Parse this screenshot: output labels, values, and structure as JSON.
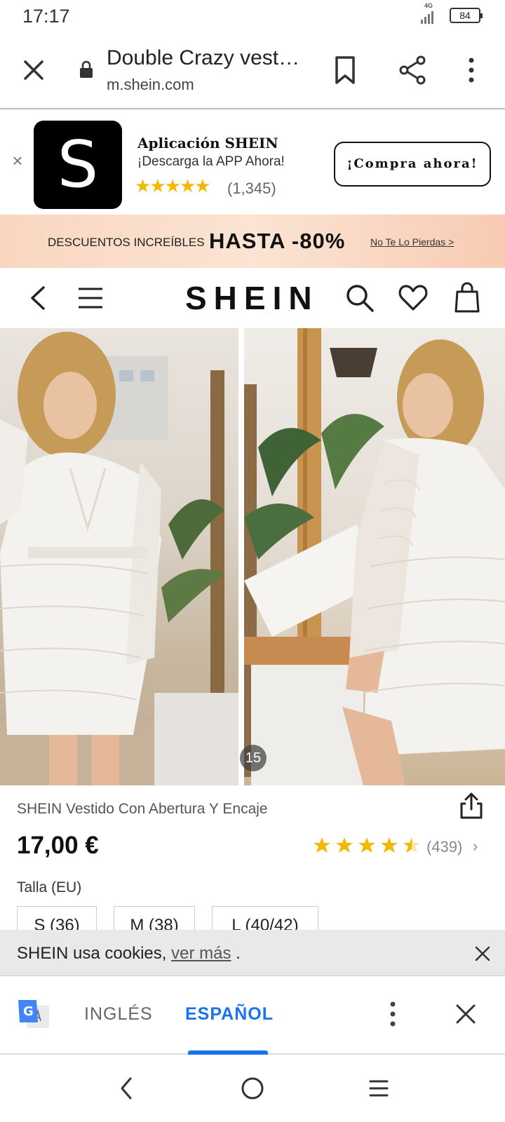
{
  "status_bar": {
    "time": "17:17",
    "network": "4G",
    "battery": "84"
  },
  "browser": {
    "title": "Double Crazy vest…",
    "url": "m.shein.com",
    "icons": [
      "close-icon",
      "lock-icon",
      "bookmark-icon",
      "share-icon",
      "more-vert-icon"
    ]
  },
  "app_banner": {
    "logo_letter": "S",
    "name": "Aplicación SHEIN",
    "tagline": "¡Descarga la APP Ahora!",
    "stars": "★★★★★",
    "rating_count": "(1,345)",
    "cta": "¡Compra ahora!"
  },
  "promo": {
    "text": "DESCUENTOS INCREÍBLES",
    "highlight": "HASTA -80%",
    "link": "No Te Lo Pierdas >"
  },
  "shop_header": {
    "logo": "SHEIN",
    "icons": [
      "back-arrow-icon",
      "menu-icon",
      "search-icon",
      "heart-icon",
      "bag-icon"
    ]
  },
  "gallery": {
    "image_counter": "15"
  },
  "product": {
    "name": "SHEIN Vestido Con Abertura Y Encaje",
    "price": "17,00 €",
    "rating_stars": 4.5,
    "rating_count": "(439)",
    "rating_chevron": "›",
    "size_label": "Talla (EU)",
    "sizes": [
      "S (36)",
      "M (38)",
      "L (40/42)"
    ]
  },
  "cookie": {
    "text": "SHEIN usa cookies, ",
    "link": "ver más",
    "suffix": " ."
  },
  "translate": {
    "source_lang": "INGLÉS",
    "target_lang": "ESPAÑOL"
  },
  "colors": {
    "accent_blue": "#1a73e8",
    "star_yellow": "#f5b800"
  }
}
